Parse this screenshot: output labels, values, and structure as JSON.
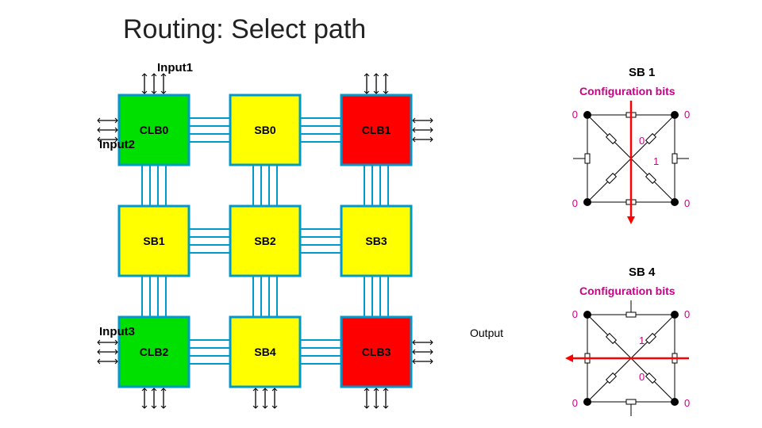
{
  "title": "Routing: Select path",
  "left": {
    "inputs": {
      "i1": "Input1",
      "i2": "Input2",
      "i3": "Input3"
    },
    "output": "Output",
    "blocks": {
      "c0": "CLB0",
      "s0": "SB0",
      "c1": "CLB1",
      "s1": "SB1",
      "s2": "SB2",
      "s3": "SB3",
      "c2": "CLB2",
      "s4": "SB4",
      "c3": "CLB3"
    },
    "colors": {
      "c0": "#00e000",
      "c1": "#ff0000",
      "c2": "#00e000",
      "c3": "#ff0000",
      "s0": "#ffff00",
      "s1": "#ffff00",
      "s2": "#ffff00",
      "s3": "#ffff00",
      "s4": "#ffff00"
    }
  },
  "right": {
    "box1_title": "SB 1",
    "box4_title": "SB 4",
    "cfg_label": "Configuration bits",
    "sb1_bits": {
      "tl": "0",
      "tr": "0",
      "ct": "0",
      "cm": "1",
      "bl": "0",
      "br": "0"
    },
    "sb4_bits": {
      "tl": "0",
      "tr": "0",
      "ct": "1",
      "cb": "0",
      "bl": "0",
      "br": "0"
    }
  }
}
